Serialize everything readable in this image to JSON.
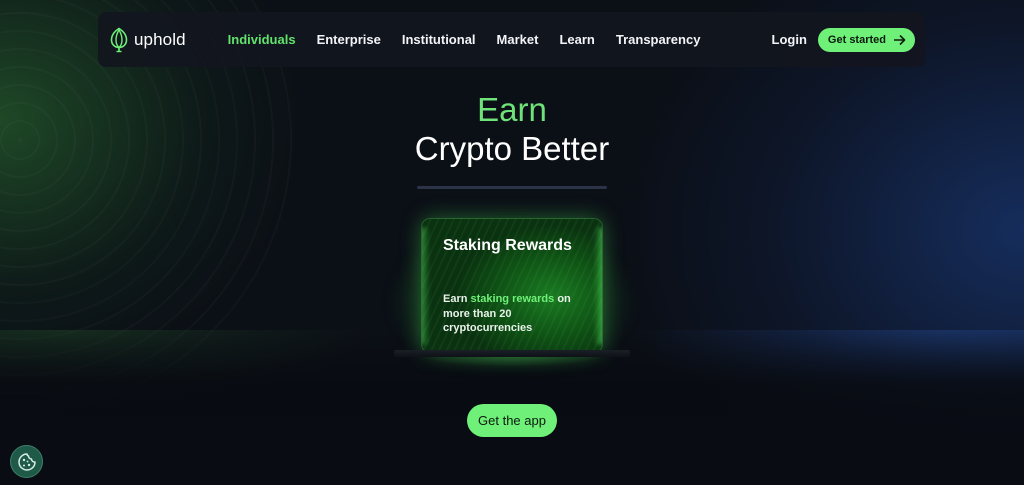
{
  "brand": {
    "name": "uphold"
  },
  "nav": {
    "links": [
      "Individuals",
      "Enterprise",
      "Institutional",
      "Market",
      "Learn",
      "Transparency"
    ],
    "active": "Individuals",
    "login_label": "Login",
    "cta_label": "Get started"
  },
  "hero": {
    "line1": "Earn",
    "line2": "Crypto Better"
  },
  "card": {
    "title": "Staking Rewards",
    "body_prefix": "Earn ",
    "body_highlight": "staking rewards",
    "body_suffix": " on more than 20 cryptocurrencies"
  },
  "app_button_label": "Get the app",
  "icons": {
    "logo": "uphold-logo-icon",
    "arrow": "arrow-right-icon",
    "cookie": "cookie-icon"
  },
  "colors": {
    "accent_green": "#6ff078",
    "active_link": "#62e36d",
    "background": "#0b0f16",
    "nav_bg": "#12161e"
  }
}
